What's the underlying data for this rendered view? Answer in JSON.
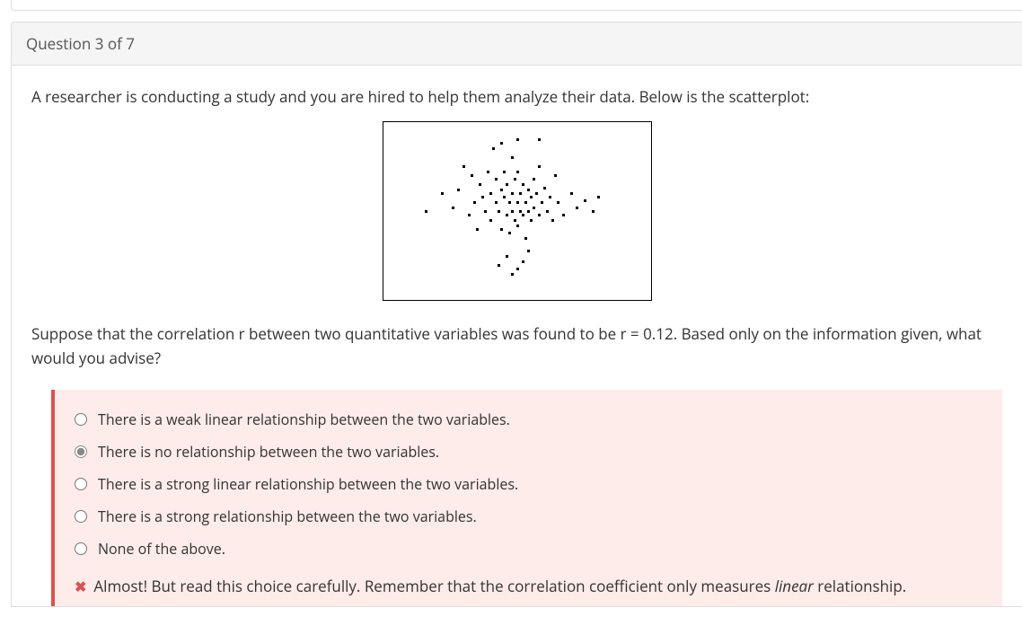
{
  "header": {
    "title": "Question 3 of 7"
  },
  "prompt1": "A researcher is conducting a study and you are hired to help them analyze their data. Below is the scatterplot:",
  "prompt2": "Suppose that the correlation r between two quantitative variables was found to be r = 0.12. Based only on the information given, what would you advise?",
  "options": [
    {
      "label": "There is a weak linear relationship between the two variables.",
      "selected": false
    },
    {
      "label": "There is no relationship between the two variables.",
      "selected": true
    },
    {
      "label": "There is a strong linear relationship between the two variables.",
      "selected": false
    },
    {
      "label": "There is a strong relationship between the two variables.",
      "selected": false
    },
    {
      "label": "None of the above.",
      "selected": false
    }
  ],
  "feedback": {
    "pre": "Almost! But read this choice carefully. Remember that the correlation coefficient only measures ",
    "italic": "linear",
    "post": " relationship."
  },
  "chart_data": {
    "type": "scatter",
    "title": "",
    "xlabel": "",
    "ylabel": "",
    "xlim": [
      0,
      100
    ],
    "ylim": [
      0,
      100
    ],
    "points": [
      [
        16,
        50
      ],
      [
        22,
        60
      ],
      [
        26,
        52
      ],
      [
        28,
        62
      ],
      [
        30,
        75
      ],
      [
        32,
        48
      ],
      [
        33,
        70
      ],
      [
        34,
        55
      ],
      [
        35,
        40
      ],
      [
        36,
        65
      ],
      [
        37,
        58
      ],
      [
        38,
        50
      ],
      [
        39,
        72
      ],
      [
        40,
        60
      ],
      [
        40,
        45
      ],
      [
        41,
        85
      ],
      [
        42,
        55
      ],
      [
        42,
        68
      ],
      [
        43,
        50
      ],
      [
        43,
        20
      ],
      [
        44,
        62
      ],
      [
        44,
        40
      ],
      [
        45,
        58
      ],
      [
        45,
        72
      ],
      [
        46,
        48
      ],
      [
        46,
        65
      ],
      [
        47,
        55
      ],
      [
        47,
        38
      ],
      [
        48,
        60
      ],
      [
        48,
        50
      ],
      [
        48,
        80
      ],
      [
        49,
        45
      ],
      [
        49,
        68
      ],
      [
        50,
        55
      ],
      [
        50,
        42
      ],
      [
        50,
        72
      ],
      [
        51,
        60
      ],
      [
        51,
        50
      ],
      [
        52,
        48
      ],
      [
        52,
        65
      ],
      [
        53,
        55
      ],
      [
        53,
        35
      ],
      [
        54,
        62
      ],
      [
        54,
        50
      ],
      [
        55,
        58
      ],
      [
        55,
        45
      ],
      [
        56,
        68
      ],
      [
        56,
        52
      ],
      [
        57,
        60
      ],
      [
        58,
        48
      ],
      [
        58,
        75
      ],
      [
        59,
        55
      ],
      [
        60,
        63
      ],
      [
        61,
        50
      ],
      [
        62,
        58
      ],
      [
        63,
        45
      ],
      [
        64,
        70
      ],
      [
        65,
        55
      ],
      [
        67,
        48
      ],
      [
        70,
        60
      ],
      [
        72,
        52
      ],
      [
        75,
        56
      ],
      [
        78,
        50
      ],
      [
        80,
        58
      ],
      [
        48,
        15
      ],
      [
        50,
        18
      ],
      [
        52,
        22
      ],
      [
        46,
        25
      ],
      [
        54,
        28
      ],
      [
        58,
        90
      ],
      [
        50,
        90
      ],
      [
        44,
        88
      ]
    ]
  }
}
